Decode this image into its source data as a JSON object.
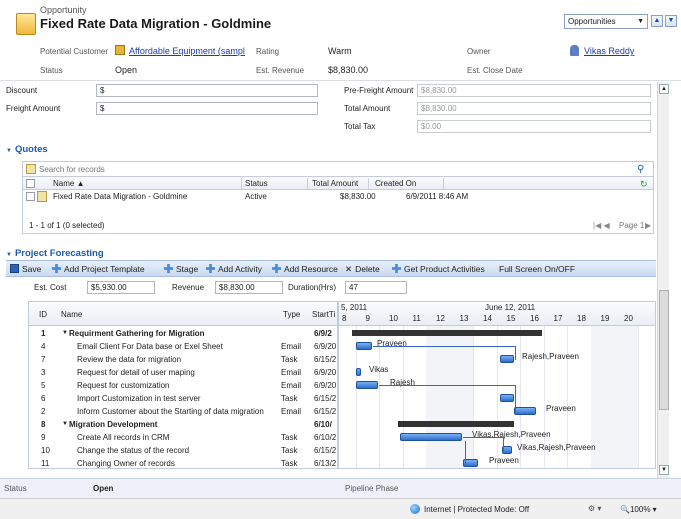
{
  "header": {
    "entity_type": "Opportunity",
    "title": "Fixed Rate Data Migration - Goldmine",
    "nav_select": "Opportunities",
    "fields": {
      "potential_customer_label": "Potential Customer",
      "potential_customer_value": "Affordable Equipment (sampl",
      "rating_label": "Rating",
      "rating_value": "Warm",
      "owner_label": "Owner",
      "owner_value": "Vikas Reddy",
      "status_label": "Status",
      "status_value": "Open",
      "est_revenue_label": "Est. Revenue",
      "est_revenue_value": "$8,830.00",
      "est_close_label": "Est. Close Date"
    }
  },
  "form": {
    "discount_label": "Discount",
    "discount_value": "$",
    "freight_label": "Freight Amount",
    "freight_value": "$",
    "pre_freight_label": "Pre-Freight Amount",
    "pre_freight_value": "$8,830.00",
    "total_amount_label": "Total Amount",
    "total_amount_value": "$8,830.00",
    "total_tax_label": "Total Tax",
    "total_tax_value": "$0.00"
  },
  "quotes": {
    "title": "Quotes",
    "search_placeholder": "Search for records",
    "columns": [
      "Name ▲",
      "Status",
      "Total Amount",
      "Created On"
    ],
    "row": {
      "name": "Fixed Rate Data Migration - Goldmine",
      "status": "Active",
      "total": "$8,830.00",
      "created": "6/9/2011 8:46 AM"
    },
    "footer_count": "1 - 1 of 1 (0 selected)",
    "footer_page": "Page 1"
  },
  "forecast": {
    "title": "Project Forecasting",
    "toolbar": [
      "Save",
      "Add Project Template",
      "Stage",
      "Add Activity",
      "Add Resource",
      "Delete",
      "Get Product Activities",
      "Full Screen On/OFF"
    ],
    "est_cost_label": "Est. Cost",
    "est_cost_value": "$5,930.00",
    "revenue_label": "Revenue",
    "revenue_value": "$8,830.00",
    "duration_label": "Duration(Hrs)",
    "duration_value": "47",
    "columns": {
      "id": "ID",
      "name": "Name",
      "type": "Type",
      "start": "StartTi"
    },
    "tasks": [
      {
        "id": "1",
        "name": "Requirment Gathering for Migration",
        "type": "",
        "start": "6/9/2",
        "summary": true
      },
      {
        "id": "4",
        "name": "Email Client For Data base or Exel Sheet",
        "type": "Email",
        "start": "6/9/20"
      },
      {
        "id": "7",
        "name": "Review the data for migration",
        "type": "Task",
        "start": "6/15/2"
      },
      {
        "id": "3",
        "name": "Request for detail of user maping",
        "type": "Email",
        "start": "6/9/20"
      },
      {
        "id": "5",
        "name": "Request for customization",
        "type": "Email",
        "start": "6/9/20"
      },
      {
        "id": "6",
        "name": "Import Customization in test server",
        "type": "Task",
        "start": "6/15/2"
      },
      {
        "id": "2",
        "name": "Inform Customer about the Starting of data migration",
        "type": "Email",
        "start": "6/15/2"
      },
      {
        "id": "8",
        "name": "Migration Development",
        "type": "",
        "start": "6/10/",
        "summary": true
      },
      {
        "id": "9",
        "name": "Create All records in CRM",
        "type": "Task",
        "start": "6/10/2"
      },
      {
        "id": "10",
        "name": "Change the status of the record",
        "type": "Task",
        "start": "6/15/2"
      },
      {
        "id": "11",
        "name": "Changing Owner of records",
        "type": "Task",
        "start": "6/13/2"
      }
    ],
    "gantt": {
      "week_left": "5, 2011",
      "week_right": "June 12, 2011",
      "days": [
        "8",
        "9",
        "10",
        "11",
        "12",
        "13",
        "14",
        "15",
        "16",
        "17",
        "18",
        "19",
        "20"
      ],
      "resources": [
        "Praveen",
        "Rajesh,Praveen",
        "Vikas",
        "Rajesh",
        "Praveen",
        "Vikas,Rajesh,Praveen",
        "Vikas,Rajesh,Praveen",
        "Praveen"
      ]
    }
  },
  "footer": {
    "status_label": "Status",
    "status_value": "Open",
    "pipeline_label": "Pipeline Phase"
  },
  "statusbar": {
    "zone": "Internet | Protected Mode: Off",
    "zoom": "100%"
  }
}
